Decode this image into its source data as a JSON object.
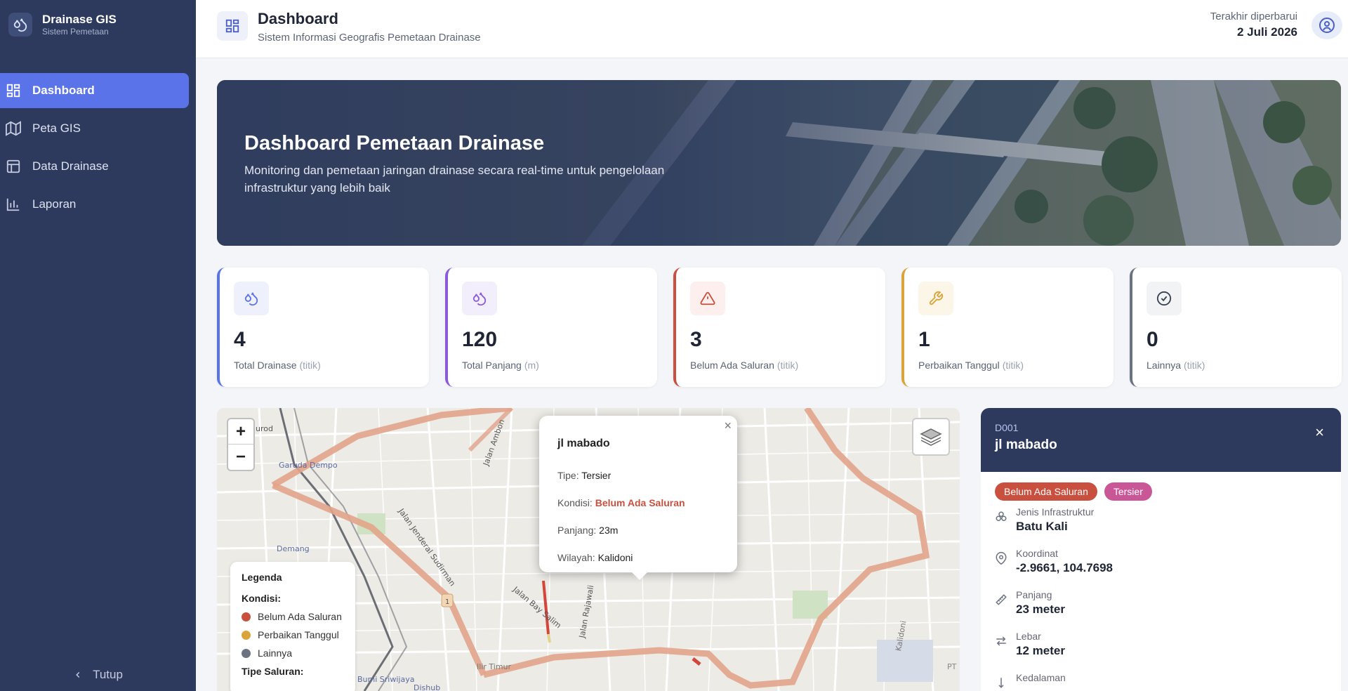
{
  "app": {
    "name": "Drainase GIS",
    "subtitle": "Sistem Pemetaan"
  },
  "sidebar": {
    "items": [
      {
        "label": "Dashboard",
        "icon": "dashboard-grid-icon",
        "active": true
      },
      {
        "label": "Peta GIS",
        "icon": "map-icon"
      },
      {
        "label": "Data Drainase",
        "icon": "table-icon"
      },
      {
        "label": "Laporan",
        "icon": "bar-chart-icon"
      }
    ],
    "collapse_label": "Tutup"
  },
  "header": {
    "title": "Dashboard",
    "subtitle": "Sistem Informasi Geografis Pemetaan Drainase",
    "updated_label": "Terakhir diperbarui",
    "updated_date": "2 Juli 2026"
  },
  "hero": {
    "title": "Dashboard Pemetaan Drainase",
    "text": "Monitoring dan pemetaan jaringan drainase secara real-time untuk pengelolaan infrastruktur yang lebih baik"
  },
  "stats": [
    {
      "value": "4",
      "label": "Total Drainase",
      "unit": "(titik)",
      "color": "#5b73e8",
      "icon": "droplets-icon"
    },
    {
      "value": "120",
      "label": "Total Panjang",
      "unit": "(m)",
      "color": "#8a5bd8",
      "icon": "droplets-icon"
    },
    {
      "value": "3",
      "label": "Belum Ada Saluran",
      "unit": "(titik)",
      "color": "#c9503f",
      "icon": "alert-triangle-icon"
    },
    {
      "value": "1",
      "label": "Perbaikan Tanggul",
      "unit": "(titik)",
      "color": "#d9a43a",
      "icon": "wrench-icon"
    },
    {
      "value": "0",
      "label": "Lainnya",
      "unit": "(titik)",
      "color": "#6b7280",
      "icon": "check-circle-icon"
    }
  ],
  "map": {
    "zoom_in": "+",
    "zoom_out": "−",
    "labels": [
      "urod",
      "Garuda Dempo",
      "Demang",
      "Jalan Jenderal Sudirman",
      "Jalan Bay Salim",
      "Jalan Rajawali",
      "Jalan Ambon",
      "Kalidoni",
      "Bumi Sriwijaya",
      "Dishub",
      "Ilir Timur",
      "PT",
      "1"
    ],
    "popup": {
      "title": "jl mabado",
      "close": "×",
      "rows": [
        {
          "label": "Tipe:",
          "value": "Tersier"
        },
        {
          "label": "Kondisi:",
          "value": "Belum Ada Saluran"
        },
        {
          "label": "Panjang:",
          "value": "23m"
        },
        {
          "label": "Wilayah:",
          "value": "Kalidoni"
        }
      ]
    },
    "legend": {
      "title": "Legenda",
      "kondisi_label": "Kondisi:",
      "items": [
        {
          "label": "Belum Ada Saluran",
          "color": "#c9503f"
        },
        {
          "label": "Perbaikan Tanggul",
          "color": "#d9a43a"
        },
        {
          "label": "Lainnya",
          "color": "#6b7280"
        }
      ],
      "tipe_label": "Tipe Saluran:"
    }
  },
  "detail": {
    "id": "D001",
    "name": "jl mabado",
    "close": "×",
    "badges": [
      {
        "label": "Belum Ada Saluran",
        "color": "#c9503f"
      },
      {
        "label": "Tersier",
        "color": "#c95797"
      }
    ],
    "fields": [
      {
        "label": "Jenis Infrastruktur",
        "value": "Batu Kali",
        "icon": "layers-icon"
      },
      {
        "label": "Koordinat",
        "value": "-2.9661, 104.7698",
        "icon": "map-pin-icon"
      },
      {
        "label": "Panjang",
        "value": "23 meter",
        "icon": "ruler-icon"
      },
      {
        "label": "Lebar",
        "value": "12 meter",
        "icon": "arrows-horizontal-icon"
      },
      {
        "label": "Kedalaman",
        "value": "",
        "icon": "depth-icon"
      }
    ]
  }
}
